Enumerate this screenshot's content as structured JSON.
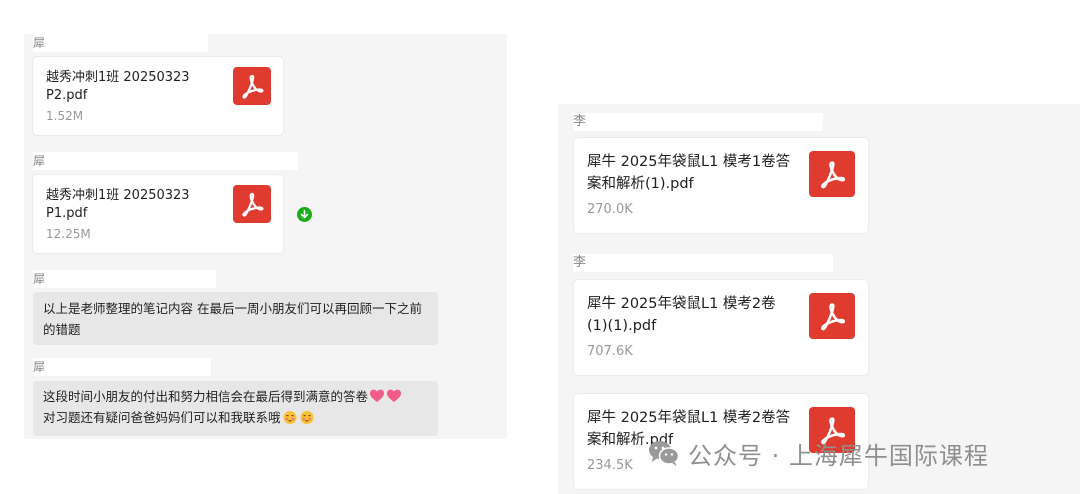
{
  "left": {
    "messages": [
      {
        "sender": "犀",
        "file_name": "越秀冲刺1班 20250323\nP2.pdf",
        "file_size": "1.52M",
        "icon": "pdf-icon"
      },
      {
        "sender": "犀",
        "file_name": "越秀冲刺1班 20250323\nP1.pdf",
        "file_size": "12.25M",
        "icon": "pdf-icon",
        "status_icon": "download-icon"
      },
      {
        "sender": "犀",
        "text": "以上是老师整理的笔记内容 在最后一周小朋友们可以再回顾一下之前的错题"
      },
      {
        "sender": "犀",
        "text_line1": " 这段时间小朋友的付出和努力相信会在最后得到满意的答卷",
        "text_line2": "对习题还有疑问爸爸妈妈们可以和我联系哦",
        "emojis": [
          "heart-emoji",
          "heart-emoji",
          "shy-face-emoji",
          "shy-face-emoji"
        ]
      }
    ]
  },
  "right": {
    "messages": [
      {
        "sender": "李",
        "file_name": "犀牛 2025年袋鼠L1 模考1卷答\n案和解析(1).pdf",
        "file_size": "270.0K",
        "icon": "pdf-icon"
      },
      {
        "sender": "李",
        "file_name": "犀牛 2025年袋鼠L1 模考2卷\n(1)(1).pdf",
        "file_size": "707.6K",
        "icon": "pdf-icon"
      },
      {
        "sender": "",
        "file_name": "犀牛 2025年袋鼠L1 模考2卷答\n案和解析.pdf",
        "file_size": "234.5K",
        "icon": "pdf-icon"
      }
    ]
  },
  "watermark": {
    "text": "公众号 · 上海犀牛国际课程",
    "icon": "wechat-icon"
  },
  "colors": {
    "pdf_red": "#e03b2f",
    "bubble_gray": "#e7e7e7",
    "panel_bg": "#f5f5f5",
    "download_green": "#1aad19"
  }
}
